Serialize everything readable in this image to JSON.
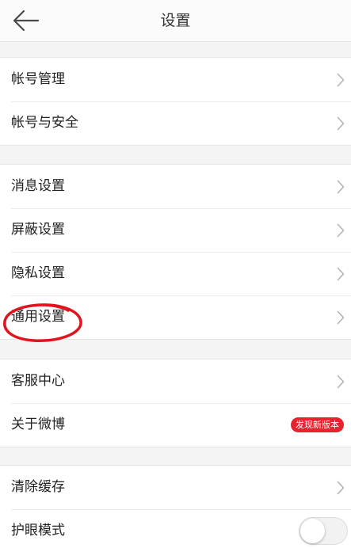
{
  "header": {
    "title": "设置",
    "back_icon": "arrow-left-icon"
  },
  "groups": [
    {
      "items": [
        {
          "label": "帐号管理",
          "accessory": "chevron-right-icon"
        },
        {
          "label": "帐号与安全",
          "accessory": "chevron-right-icon"
        }
      ]
    },
    {
      "items": [
        {
          "label": "消息设置",
          "accessory": "chevron-right-icon"
        },
        {
          "label": "屏蔽设置",
          "accessory": "chevron-right-icon"
        },
        {
          "label": "隐私设置",
          "accessory": "chevron-right-icon"
        },
        {
          "label": "通用设置",
          "accessory": "chevron-right-icon",
          "highlighted": true
        }
      ]
    },
    {
      "items": [
        {
          "label": "客服中心",
          "accessory": "chevron-right-icon"
        },
        {
          "label": "关于微博",
          "badge": "发现新版本"
        }
      ]
    },
    {
      "items": [
        {
          "label": "清除缓存",
          "accessory": "chevron-right-icon"
        },
        {
          "label": "护眼模式",
          "toggle": false
        }
      ]
    }
  ],
  "colors": {
    "badge_background": "#e8222e",
    "annotation_circle": "#e0141e",
    "page_background": "#f4f4f4",
    "row_background": "#ffffff"
  }
}
